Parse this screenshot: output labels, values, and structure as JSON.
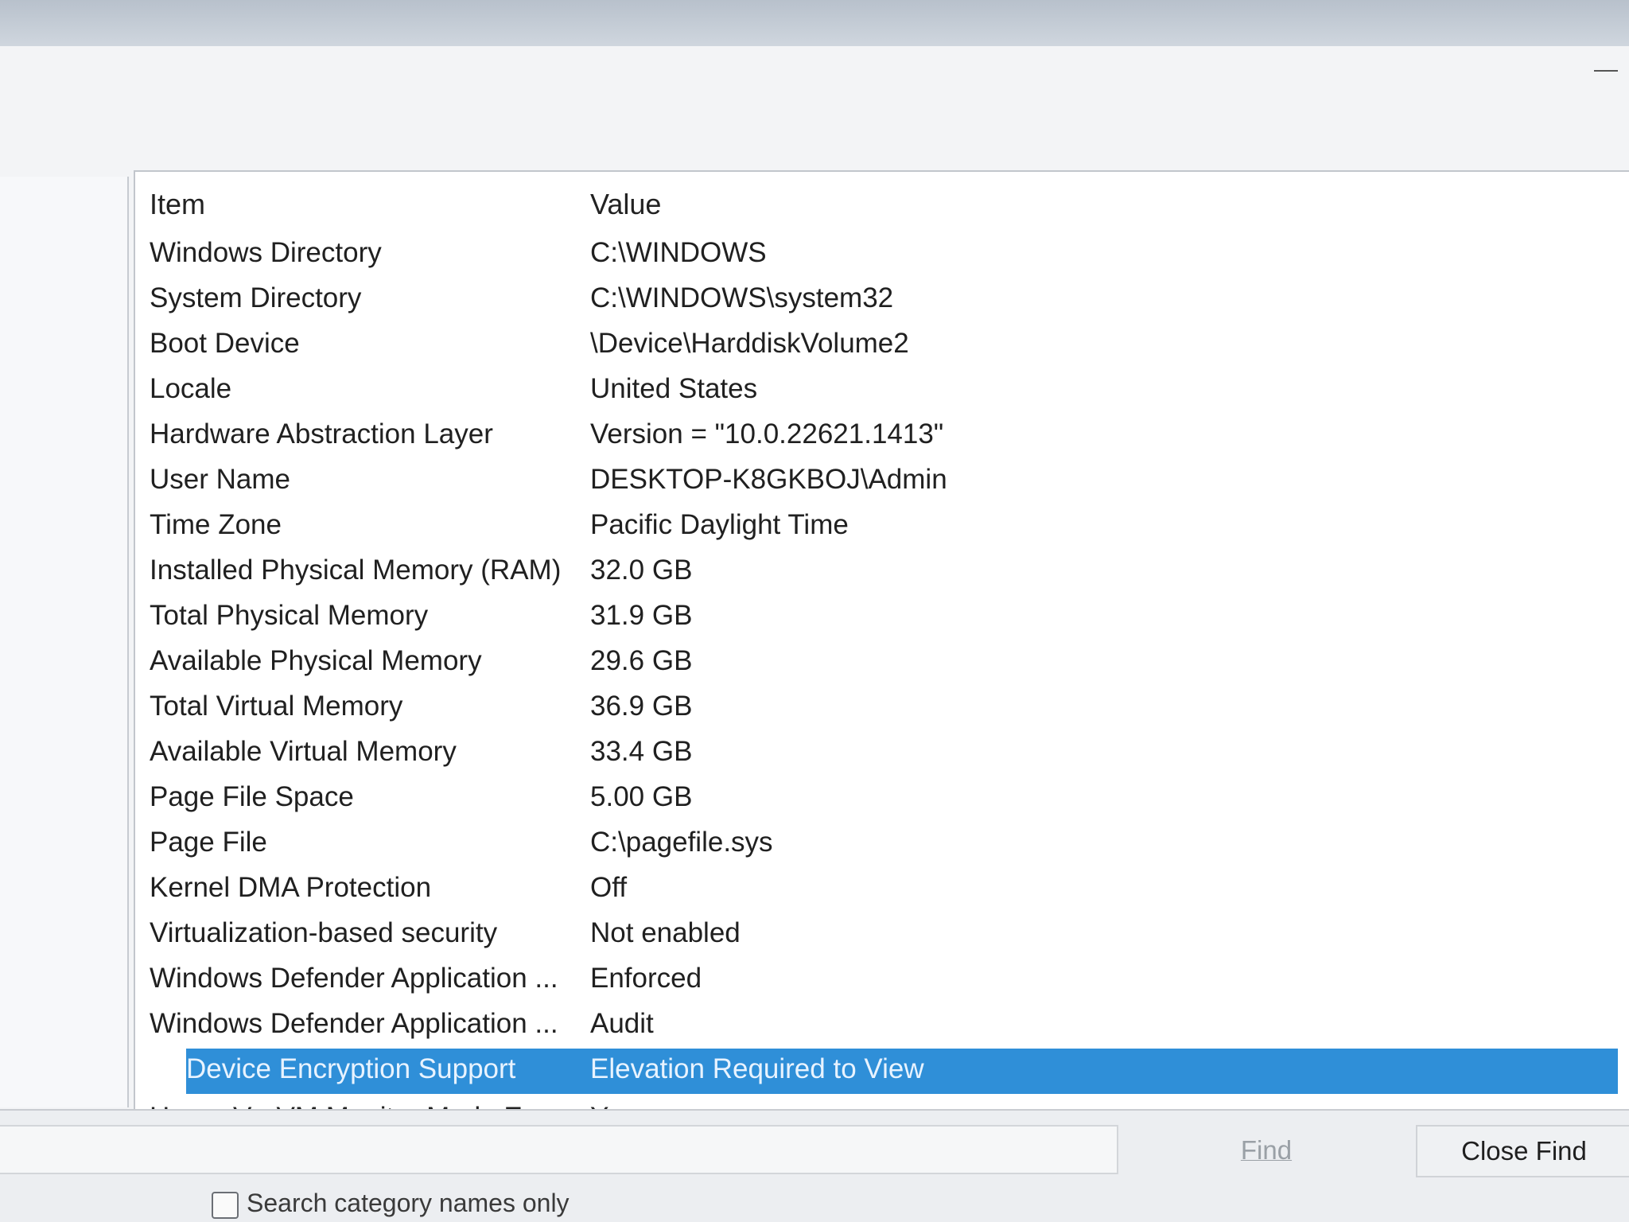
{
  "list": {
    "header": {
      "item": "Item",
      "value": "Value"
    },
    "rows": [
      {
        "item": "Windows Directory",
        "value": "C:\\WINDOWS"
      },
      {
        "item": "System Directory",
        "value": "C:\\WINDOWS\\system32"
      },
      {
        "item": "Boot Device",
        "value": "\\Device\\HarddiskVolume2"
      },
      {
        "item": "Locale",
        "value": "United States"
      },
      {
        "item": "Hardware Abstraction Layer",
        "value": "Version = \"10.0.22621.1413\""
      },
      {
        "item": "User Name",
        "value": "DESKTOP-K8GKBOJ\\Admin"
      },
      {
        "item": "Time Zone",
        "value": "Pacific Daylight Time"
      },
      {
        "item": "Installed Physical Memory (RAM)",
        "value": "32.0 GB"
      },
      {
        "item": "Total Physical Memory",
        "value": "31.9 GB"
      },
      {
        "item": "Available Physical Memory",
        "value": "29.6 GB"
      },
      {
        "item": "Total Virtual Memory",
        "value": "36.9 GB"
      },
      {
        "item": "Available Virtual Memory",
        "value": "33.4 GB"
      },
      {
        "item": "Page File Space",
        "value": "5.00 GB"
      },
      {
        "item": "Page File",
        "value": "C:\\pagefile.sys"
      },
      {
        "item": "Kernel DMA Protection",
        "value": "Off"
      },
      {
        "item": "Virtualization-based security",
        "value": "Not enabled"
      },
      {
        "item": "Windows Defender Application ...",
        "value": "Enforced"
      },
      {
        "item": "Windows Defender Application ...",
        "value": "Audit"
      },
      {
        "item": "Device Encryption Support",
        "value": "Elevation Required to View"
      },
      {
        "item": "Hyper-V - VM Monitor Mode Ex...",
        "value": "Yes"
      }
    ],
    "selected_row": 18,
    "selected_color": "#2f8fd8"
  },
  "find": {
    "find_label": "Find",
    "close_find_label": "Close Find",
    "search_option_label": "Search category names only",
    "search_option_checked": false
  }
}
